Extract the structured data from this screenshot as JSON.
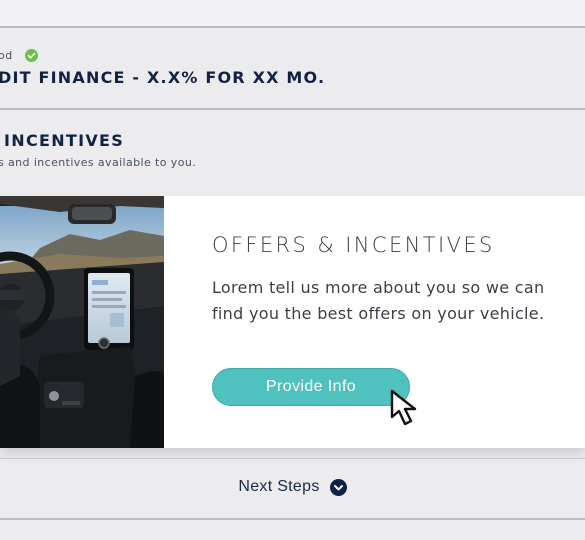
{
  "payment_method": {
    "label": "od",
    "title": "DIT FINANCE - X.X% FOR XX MO."
  },
  "incentives_section": {
    "heading": "INCENTIVES",
    "subtitle": "s and incentives available to you."
  },
  "offer_card": {
    "title": "OFFERS & INCENTIVES",
    "description": "Lorem tell us more about you so we can find you the best offers on your vehicle.",
    "button_label": "Provide Info"
  },
  "footer": {
    "next_steps_label": "Next Steps"
  },
  "colors": {
    "accent_button": "#4fc2c0",
    "check_green": "#6cc04a",
    "navy": "#112244"
  },
  "icons": [
    "check-icon",
    "pointer-cursor-icon",
    "chevron-down-icon"
  ]
}
